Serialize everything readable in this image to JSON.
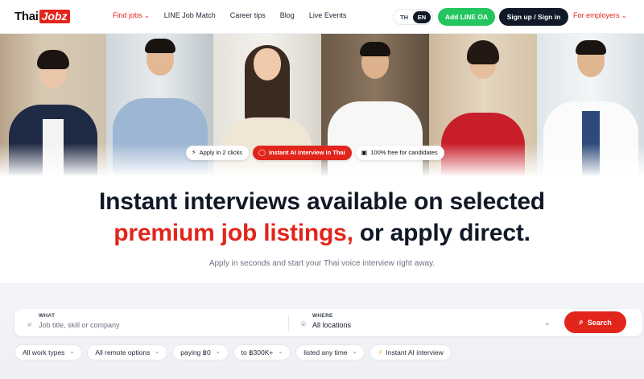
{
  "nav": {
    "logo_thai": "Thai",
    "logo_jobz": "Jobz",
    "links": [
      "Find jobs",
      "LINE Job Match",
      "Career tips",
      "Blog",
      "Live Events"
    ],
    "find_jobs_chevron": "⌄",
    "lang_th": "TH",
    "lang_en": "EN",
    "add_line": "Add LINE OA",
    "sign_in": "Sign up / Sign in",
    "employers": "For employers",
    "employers_chevron": "⌄"
  },
  "hero": {
    "chips": [
      "Apply in 2 clicks",
      "Instant AI interview in Thai",
      "100% free for candidates"
    ]
  },
  "headline": {
    "line1": "Instant interviews available on selected",
    "line2_red": "premium job listings,",
    "line2_rest": " or apply direct."
  },
  "subtitle": "Apply in seconds and start your Thai voice interview right away.",
  "search": {
    "what_label": "WHAT",
    "what_placeholder": "Job title, skill or company",
    "where_label": "WHERE",
    "where_value": "All locations",
    "button": "Search"
  },
  "filters": [
    "All work types",
    "All remote options",
    "paying ฿0",
    "to ฿300K+",
    "listed any time",
    "Instant AI interview"
  ],
  "colors": {
    "brand_red": "#e1251b",
    "line_green": "#22c55e",
    "dark": "#111827"
  }
}
